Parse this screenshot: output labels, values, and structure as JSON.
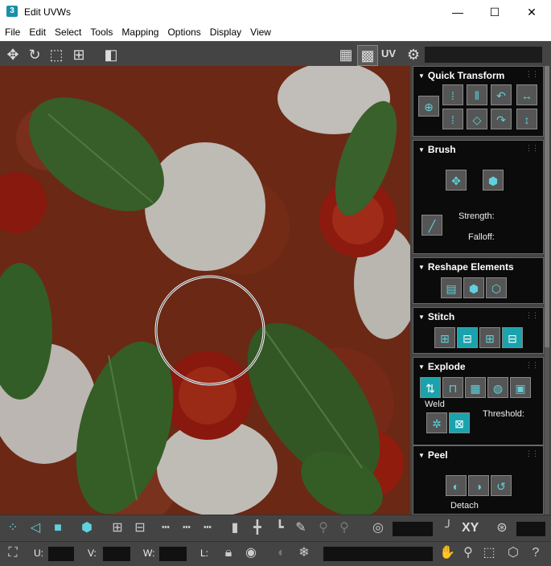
{
  "window": {
    "app_icon": "3",
    "title": "Edit UVWs",
    "minimize": "—",
    "maximize": "☐",
    "close": "✕"
  },
  "menu": [
    "File",
    "Edit",
    "Select",
    "Tools",
    "Mapping",
    "Options",
    "Display",
    "View"
  ],
  "toolbar": {
    "uv_label": "UV"
  },
  "rollouts": {
    "quick_transform": {
      "title": "Quick Transform"
    },
    "brush": {
      "title": "Brush",
      "strength_label": "Strength:",
      "falloff_label": "Falloff:"
    },
    "reshape": {
      "title": "Reshape Elements"
    },
    "stitch": {
      "title": "Stitch"
    },
    "explode": {
      "title": "Explode",
      "weld_label": "Weld",
      "threshold_label": "Threshold:"
    },
    "peel": {
      "title": "Peel",
      "detach_label": "Detach"
    }
  },
  "bottom": {
    "xy_label": "XY",
    "u_label": "U:",
    "v_label": "V:",
    "w_label": "W:",
    "l_label": "L:"
  },
  "colors": {
    "panel_bg": "#444444",
    "rollout_bg": "#0b0b0b",
    "accent": "#1aa3ad"
  }
}
